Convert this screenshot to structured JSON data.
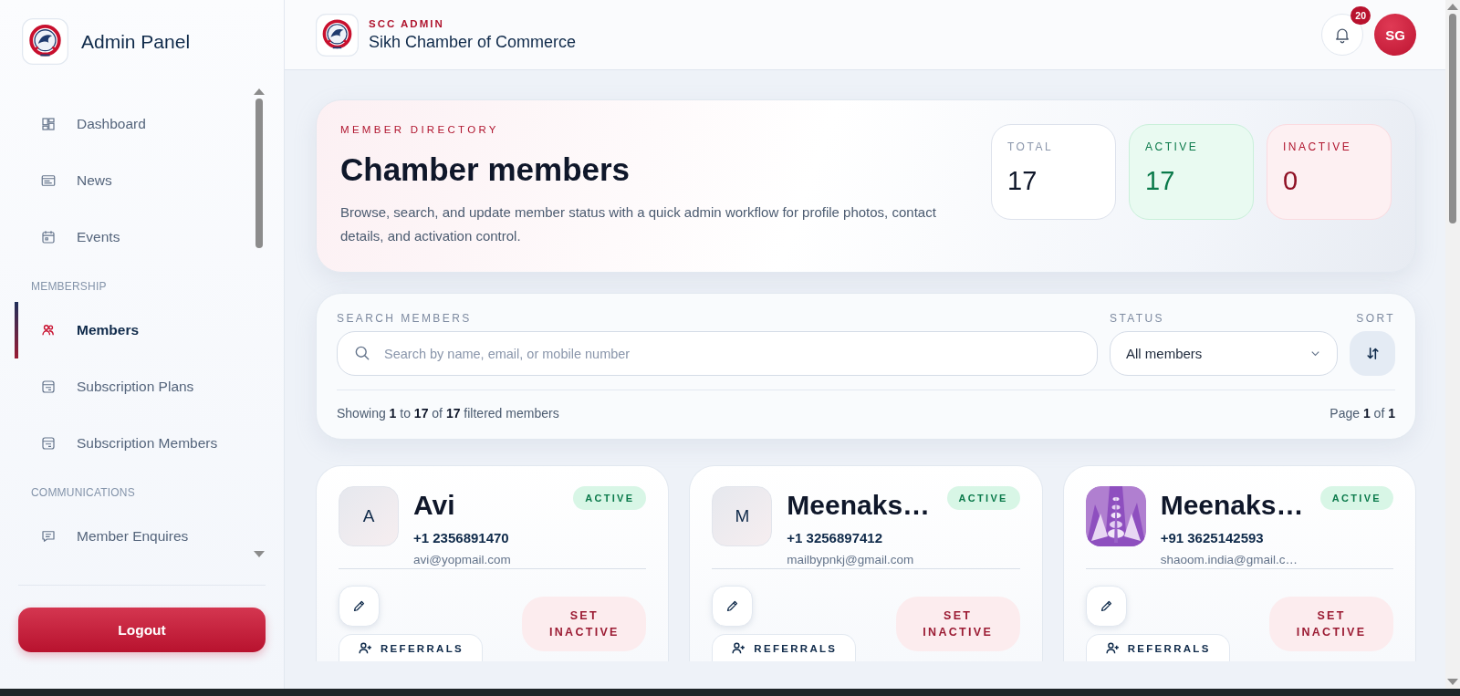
{
  "sidebar": {
    "title": "Admin Panel",
    "nav": [
      {
        "kind": "item",
        "label": "Dashboard",
        "selected": false
      },
      {
        "kind": "item",
        "label": "News",
        "selected": false
      },
      {
        "kind": "item",
        "label": "Events",
        "selected": false
      },
      {
        "kind": "heading",
        "label": "MEMBERSHIP"
      },
      {
        "kind": "item",
        "label": "Members",
        "selected": true
      },
      {
        "kind": "item",
        "label": "Subscription Plans",
        "selected": false
      },
      {
        "kind": "item",
        "label": "Subscription Members",
        "selected": false
      },
      {
        "kind": "heading",
        "label": "COMMUNICATIONS"
      },
      {
        "kind": "item",
        "label": "Member Enquires",
        "selected": false
      }
    ],
    "logout": "Logout"
  },
  "header": {
    "eyebrow": "SCC ADMIN",
    "title": "Sikh Chamber of Commerce",
    "notifications": "20",
    "user_initials": "SG"
  },
  "hero": {
    "eyebrow": "MEMBER DIRECTORY",
    "title": "Chamber members",
    "description": "Browse, search, and update member status with a quick admin workflow for profile photos, contact details, and activation control.",
    "stats": [
      {
        "kind": "total",
        "label": "TOTAL",
        "value": "17"
      },
      {
        "kind": "active",
        "label": "ACTIVE",
        "value": "17"
      },
      {
        "kind": "inactive",
        "label": "INACTIVE",
        "value": "0"
      }
    ]
  },
  "filters": {
    "search_label": "SEARCH MEMBERS",
    "search_placeholder": "Search by name, email, or mobile number",
    "status_label": "STATUS",
    "status_value": "All members",
    "sort_label": "SORT",
    "summary": "Showing **1** to **17** of **17** filtered members",
    "page": "Page **1** of **1**"
  },
  "members": [
    {
      "name": "Avi",
      "avatar": {
        "kind": "initial",
        "text": "A"
      },
      "phone": "+1 2356891470",
      "email": "avi@yopmail.com",
      "status": "ACTIVE",
      "active": true,
      "toggle": "SET INACTIVE",
      "referrals": "REFERRALS"
    },
    {
      "name": "Meenaks…",
      "avatar": {
        "kind": "initial",
        "text": "M"
      },
      "phone": "+1 3256897412",
      "email": "mailbypnkj@gmail.com",
      "status": "ACTIVE",
      "active": true,
      "toggle": "SET INACTIVE",
      "referrals": "REFERRALS"
    },
    {
      "name": "Meenaks…",
      "phone": "+91 3625142593",
      "email": "shaoom.india@gmail.c…",
      "status": "ACTIVE",
      "active": true,
      "toggle": "SET INACTIVE",
      "referrals": "REFERRALS"
    }
  ]
}
